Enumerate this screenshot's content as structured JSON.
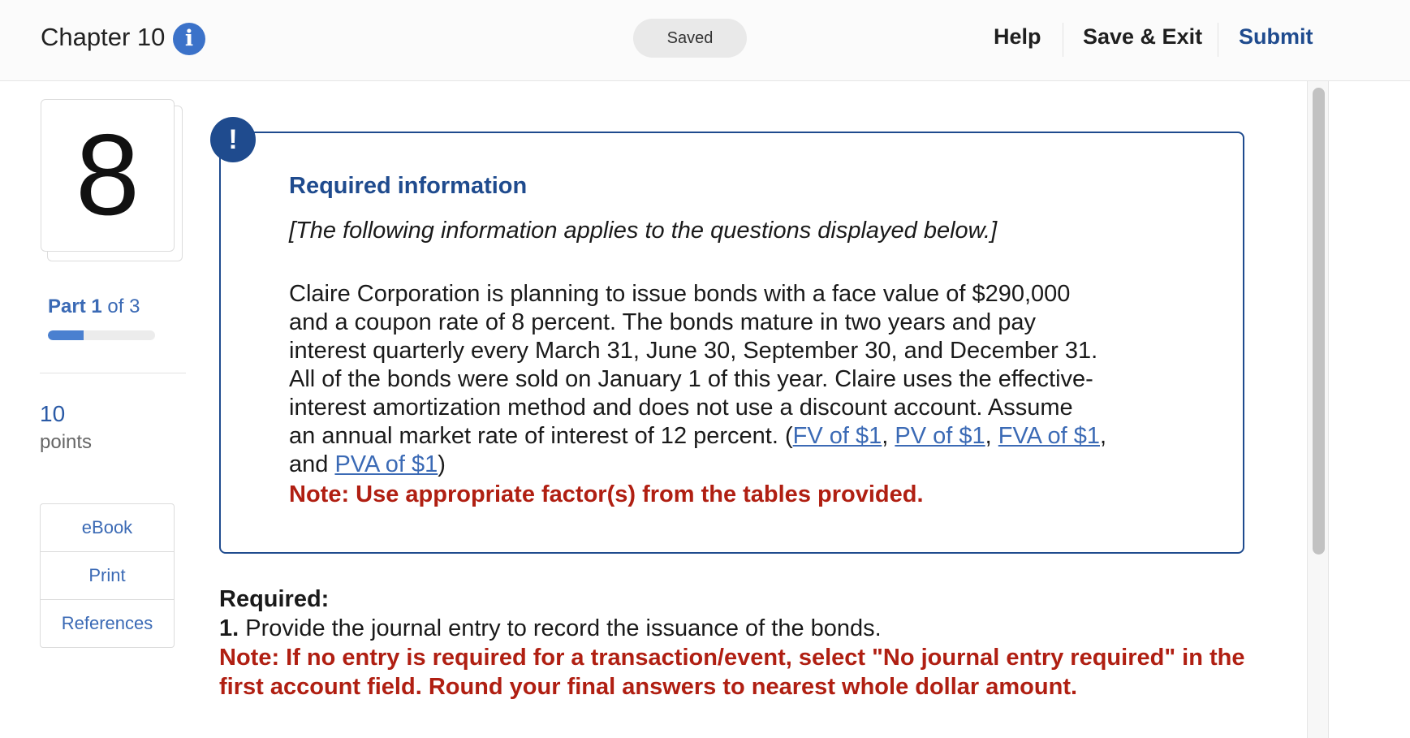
{
  "header": {
    "chapter_title": "Chapter 10",
    "info_icon": "info-icon",
    "saved_status": "Saved",
    "help_label": "Help",
    "save_exit_label": "Save & Exit",
    "submit_label": "Submit"
  },
  "sidebar": {
    "question_number": "8",
    "part_word": "Part",
    "part_current": "1",
    "part_total_text": "of 3",
    "part_progress_fraction": 0.33,
    "points_value": "10",
    "points_label": "points",
    "tools": [
      {
        "label": "eBook"
      },
      {
        "label": "Print"
      },
      {
        "label": "References"
      }
    ]
  },
  "info_box": {
    "alert_icon": "exclamation-icon",
    "alert_symbol": "!",
    "title": "Required information",
    "italic_text": "[The following information applies to the questions displayed below.]",
    "paragraph_lines": [
      "Claire Corporation is planning to issue bonds with a face value of $290,000",
      "and a coupon rate of 8 percent. The bonds mature in two years and pay",
      "interest quarterly every March 31, June 30, September 30, and December 31.",
      "All of the bonds were sold on January 1 of this year. Claire uses the effective-",
      "interest amortization method and does not use a discount account. Assume"
    ],
    "line6_prefix": "an annual market rate of interest of 12 percent. (",
    "link_fv": "FV of $1",
    "link_pv": "PV of $1",
    "link_fva": "FVA of $1",
    "comma1": ", ",
    "comma2": ", ",
    "comma3": ",",
    "line7_prefix": "and ",
    "link_pva": "PVA of $1",
    "line7_suffix": ")",
    "note": "Note: Use appropriate factor(s) from the tables provided."
  },
  "required": {
    "label": "Required:",
    "item_number": "1.",
    "item_text": " Provide the journal entry to record the issuance of the bonds.",
    "note_line1": "Note: If no entry is required for a transaction/event, select \"No journal entry required\" in the",
    "note_line2": "first account field. Round your final answers to nearest whole dollar amount."
  }
}
